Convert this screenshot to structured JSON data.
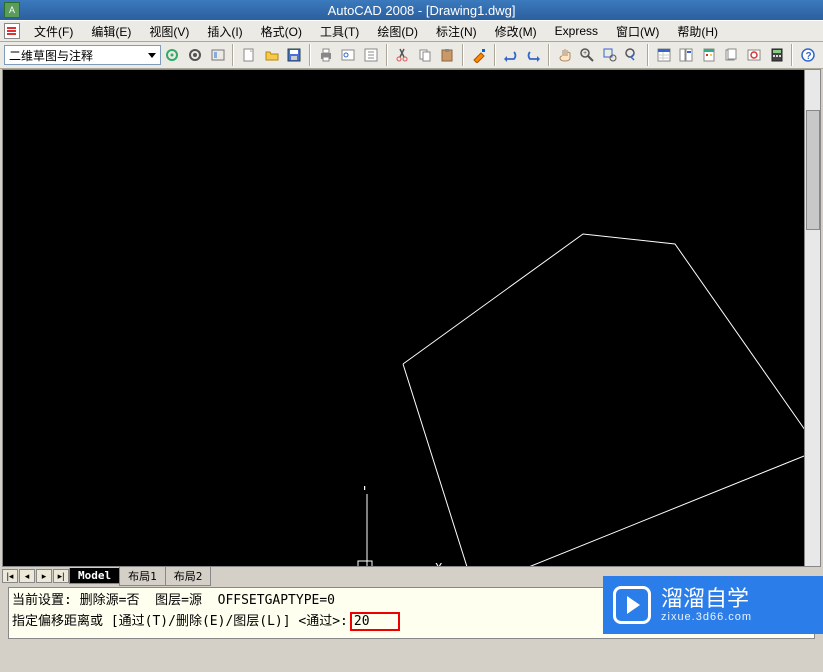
{
  "title": "AutoCAD 2008 - [Drawing1.dwg]",
  "menu": {
    "file": "文件(F)",
    "edit": "编辑(E)",
    "view": "视图(V)",
    "insert": "插入(I)",
    "format": "格式(O)",
    "tools": "工具(T)",
    "draw": "绘图(D)",
    "dimension": "标注(N)",
    "modify": "修改(M)",
    "express": "Express",
    "window": "窗口(W)",
    "help": "帮助(H)"
  },
  "workspace_combo": "二维草图与注释",
  "ucs": {
    "x_label": "X",
    "y_label": "Y"
  },
  "tabs": {
    "model": "Model",
    "layout1": "布局1",
    "layout2": "布局2"
  },
  "command": {
    "line1": "当前设置: 删除源=否  图层=源  OFFSETGAPTYPE=0",
    "prompt": "指定偏移距离或 [通过(T)/删除(E)/图层(L)] <通过>:",
    "input": "20"
  },
  "watermark": {
    "brand": "溜溜自学",
    "url": "zixue.3d66.com"
  }
}
